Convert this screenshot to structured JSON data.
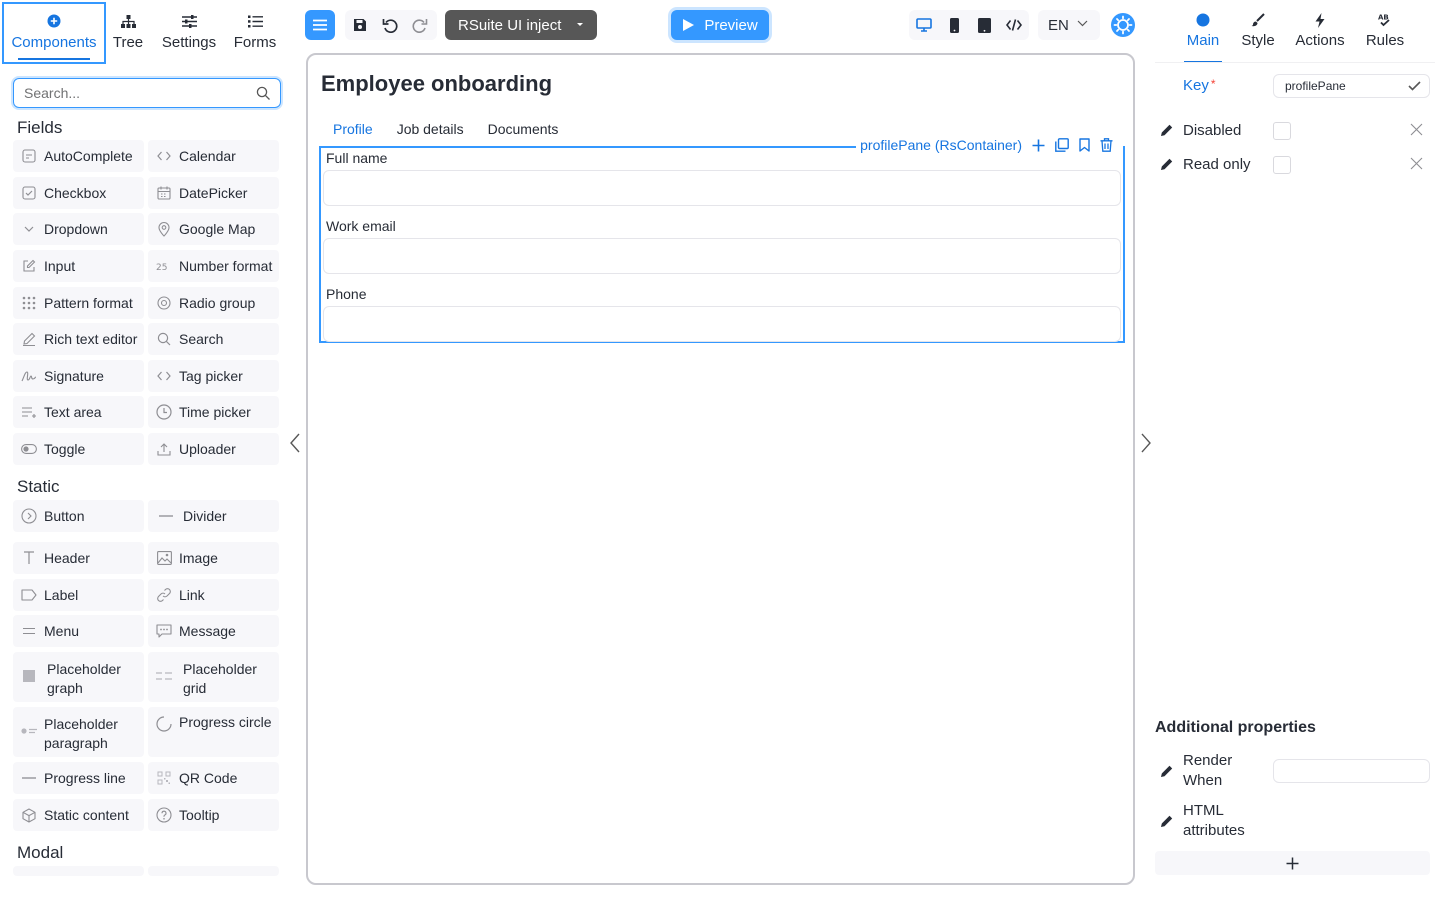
{
  "left_tabs": [
    {
      "label": "Components",
      "icon": "plus-circle-icon",
      "active": true
    },
    {
      "label": "Tree",
      "icon": "sitemap-icon"
    },
    {
      "label": "Settings",
      "icon": "sliders-icon"
    },
    {
      "label": "Forms",
      "icon": "list-icon"
    }
  ],
  "search": {
    "placeholder": "Search..."
  },
  "sections": {
    "fields": "Fields",
    "static": "Static",
    "modal": "Modal"
  },
  "fields": [
    {
      "label": "AutoComplete",
      "icon": "autocomplete-icon"
    },
    {
      "label": "Calendar",
      "icon": "code-brackets-icon"
    },
    {
      "label": "Checkbox",
      "icon": "checkbox-icon"
    },
    {
      "label": "DatePicker",
      "icon": "calendar-icon"
    },
    {
      "label": "Dropdown",
      "icon": "chevron-down-icon"
    },
    {
      "label": "Google Map",
      "icon": "map-pin-icon"
    },
    {
      "label": "Input",
      "icon": "edit-icon"
    },
    {
      "label": "Number format",
      "icon": "number-icon"
    },
    {
      "label": "Pattern format",
      "icon": "grid-dots-icon"
    },
    {
      "label": "Radio group",
      "icon": "radio-icon"
    },
    {
      "label": "Rich text editor",
      "icon": "pen-icon"
    },
    {
      "label": "Search",
      "icon": "search-icon"
    },
    {
      "label": "Signature",
      "icon": "signature-icon"
    },
    {
      "label": "Tag picker",
      "icon": "code-brackets-icon"
    },
    {
      "label": "Text area",
      "icon": "text-area-icon"
    },
    {
      "label": "Time picker",
      "icon": "clock-icon"
    },
    {
      "label": "Toggle",
      "icon": "toggle-icon"
    },
    {
      "label": "Uploader",
      "icon": "upload-icon"
    }
  ],
  "statics": [
    {
      "label": "Button",
      "icon": "button-icon"
    },
    {
      "label": "Divider",
      "icon": "divider-icon"
    },
    {
      "label": "Header",
      "icon": "header-icon"
    },
    {
      "label": "Image",
      "icon": "image-icon"
    },
    {
      "label": "Label",
      "icon": "label-icon"
    },
    {
      "label": "Link",
      "icon": "link-icon"
    },
    {
      "label": "Menu",
      "icon": "menu-icon"
    },
    {
      "label": "Message",
      "icon": "message-icon"
    },
    {
      "label": "Placeholder graph",
      "icon": "placeholder-graph-icon"
    },
    {
      "label": "Placeholder grid",
      "icon": "placeholder-grid-icon"
    },
    {
      "label": "Placeholder paragraph",
      "icon": "placeholder-paragraph-icon"
    },
    {
      "label": "Progress circle",
      "icon": "progress-circle-icon"
    },
    {
      "label": "Progress line",
      "icon": "progress-line-icon"
    },
    {
      "label": "QR Code",
      "icon": "qr-code-icon"
    },
    {
      "label": "Static content",
      "icon": "cube-icon"
    },
    {
      "label": "Tooltip",
      "icon": "help-icon"
    }
  ],
  "toolbar": {
    "inject_label": "RSuite UI inject",
    "preview_label": "Preview",
    "language": "EN"
  },
  "canvas": {
    "title": "Employee onboarding",
    "tabs": [
      "Profile",
      "Job details",
      "Documents"
    ],
    "active_tab": "Profile",
    "pane_label": "profilePane (RsContainer)",
    "fields": [
      {
        "label": "Full name",
        "value": ""
      },
      {
        "label": "Work email",
        "value": ""
      },
      {
        "label": "Phone",
        "value": ""
      }
    ]
  },
  "right_tabs": [
    {
      "label": "Main",
      "icon": "circle-icon",
      "active": true
    },
    {
      "label": "Style",
      "icon": "brush-icon"
    },
    {
      "label": "Actions",
      "icon": "bolt-icon"
    },
    {
      "label": "Rules",
      "icon": "rules-icon"
    }
  ],
  "props": {
    "key_label": "Key",
    "key_required": "*",
    "key_value": "profilePane",
    "disabled_label": "Disabled",
    "readonly_label": "Read only",
    "additional_title": "Additional properties",
    "render_when_label": "Render When",
    "html_attributes_label": "HTML attributes"
  },
  "colors": {
    "accent": "#3498ff",
    "accent_text": "#1675e0",
    "inject_bg": "#575757",
    "required": "#f44336"
  }
}
